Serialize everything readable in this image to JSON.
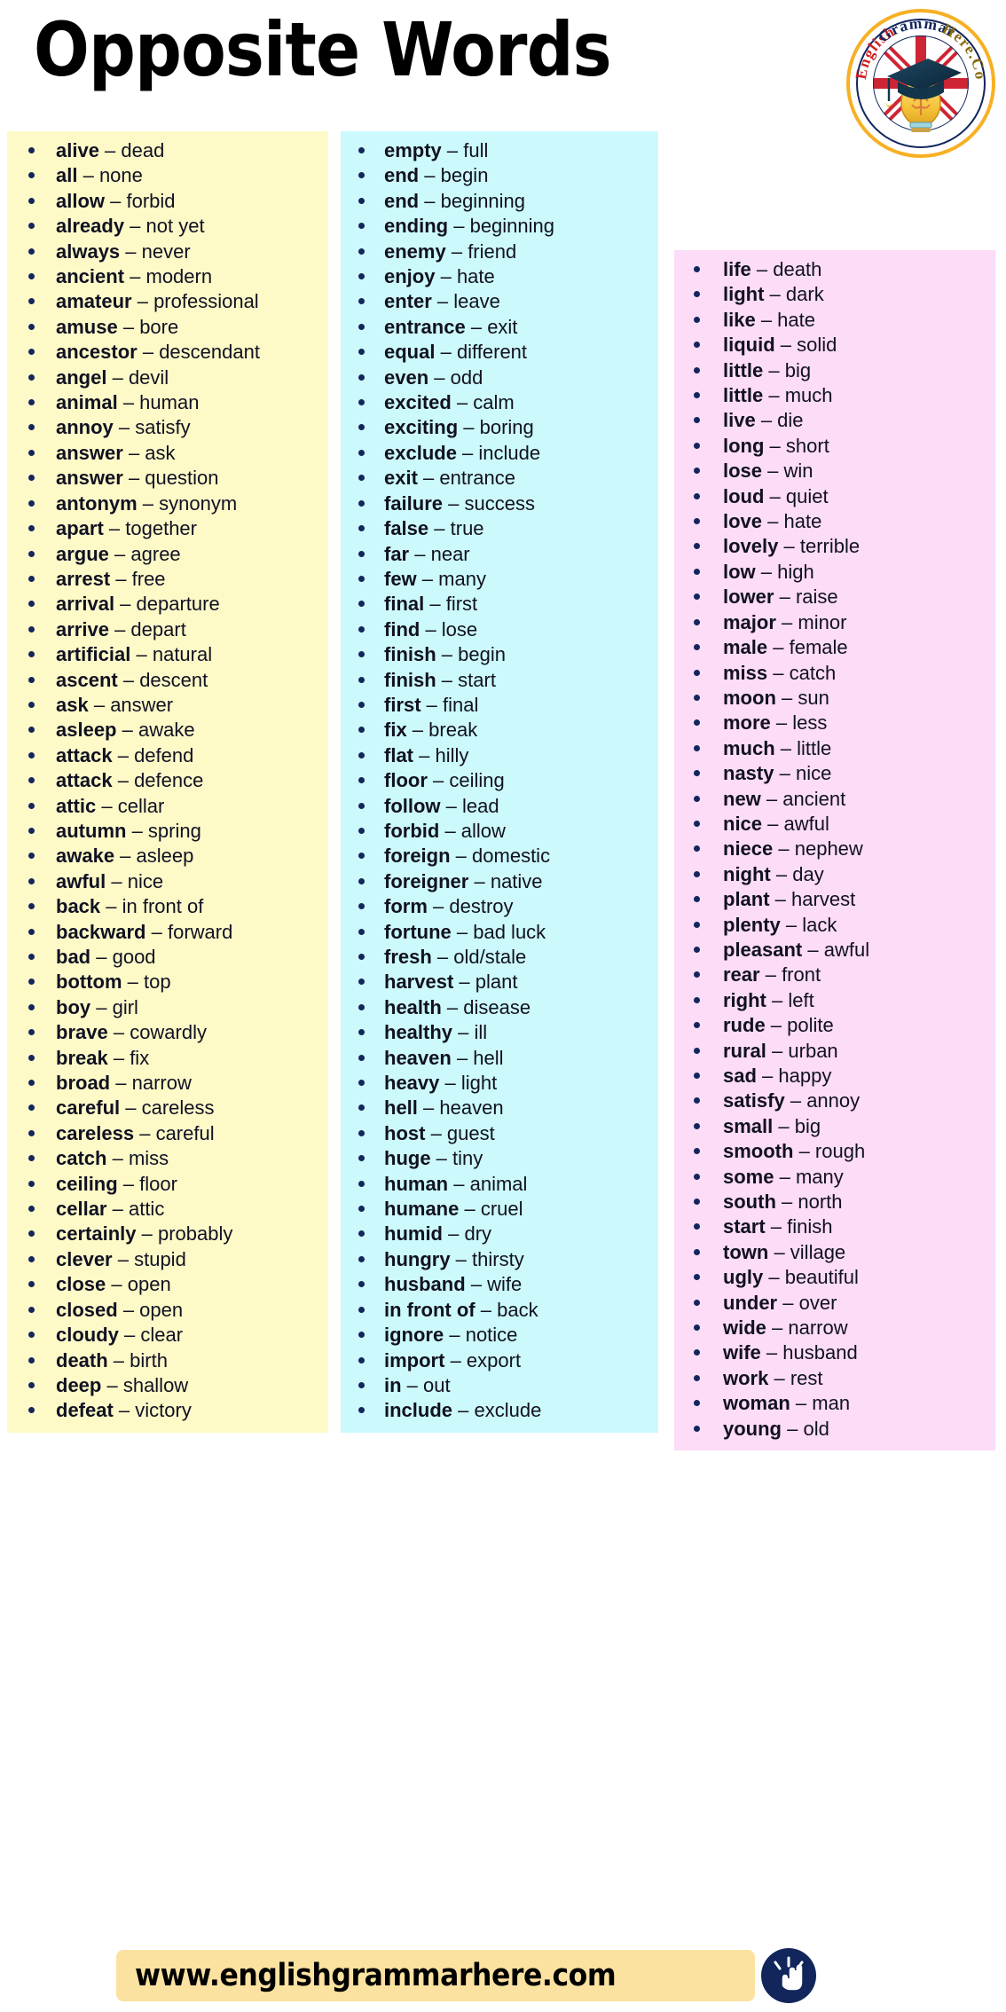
{
  "header": {
    "title": "Opposite Words",
    "logo": {
      "text": "English Grammar Here.Com",
      "alt_name": "english-grammar-here-logo",
      "ring_color": "#f7b024",
      "text_color_left": "#d42020",
      "text_color_mid": "#12265c",
      "text_color_right": "#8a6a10"
    }
  },
  "colors": {
    "column1_bg": "#fdfac8",
    "column2_bg": "#ccf9fb",
    "column3_bg": "#fcdcf6",
    "bullet": "#12265c",
    "text": "#111122",
    "footer_pill": "#fbe2a0",
    "footer_icon": "#12265c"
  },
  "columns": [
    {
      "name": "column-1",
      "bg": "#fdfac8",
      "pairs": [
        {
          "word": "alive",
          "opposite": "dead"
        },
        {
          "word": "all",
          "opposite": "none"
        },
        {
          "word": "allow",
          "opposite": "forbid"
        },
        {
          "word": "already",
          "opposite": "not yet"
        },
        {
          "word": "always",
          "opposite": "never"
        },
        {
          "word": "ancient",
          "opposite": "modern"
        },
        {
          "word": "amateur",
          "opposite": "professional"
        },
        {
          "word": "amuse",
          "opposite": "bore"
        },
        {
          "word": "ancestor",
          "opposite": "descendant"
        },
        {
          "word": "angel",
          "opposite": "devil"
        },
        {
          "word": "animal",
          "opposite": "human"
        },
        {
          "word": "annoy",
          "opposite": "satisfy"
        },
        {
          "word": "answer",
          "opposite": "ask"
        },
        {
          "word": "answer",
          "opposite": "question"
        },
        {
          "word": "antonym",
          "opposite": "synonym"
        },
        {
          "word": "apart",
          "opposite": "together"
        },
        {
          "word": "argue",
          "opposite": "agree"
        },
        {
          "word": "arrest",
          "opposite": "free"
        },
        {
          "word": "arrival",
          "opposite": "departure"
        },
        {
          "word": "arrive",
          "opposite": "depart"
        },
        {
          "word": "artificial",
          "opposite": "natural"
        },
        {
          "word": "ascent",
          "opposite": "descent"
        },
        {
          "word": "ask",
          "opposite": "answer"
        },
        {
          "word": "asleep",
          "opposite": "awake"
        },
        {
          "word": "attack",
          "opposite": "defend"
        },
        {
          "word": "attack",
          "opposite": "defence"
        },
        {
          "word": "attic",
          "opposite": "cellar"
        },
        {
          "word": "autumn",
          "opposite": "spring"
        },
        {
          "word": "awake",
          "opposite": "asleep"
        },
        {
          "word": "awful",
          "opposite": "nice"
        },
        {
          "word": "back",
          "opposite": "in front of"
        },
        {
          "word": "backward",
          "opposite": "forward"
        },
        {
          "word": "bad",
          "opposite": "good"
        },
        {
          "word": "bottom",
          "opposite": "top"
        },
        {
          "word": "boy",
          "opposite": "girl"
        },
        {
          "word": "brave",
          "opposite": "cowardly"
        },
        {
          "word": "break",
          "opposite": "fix"
        },
        {
          "word": "broad",
          "opposite": "narrow"
        },
        {
          "word": "careful",
          "opposite": "careless"
        },
        {
          "word": "careless",
          "opposite": "careful"
        },
        {
          "word": "catch",
          "opposite": "miss"
        },
        {
          "word": "ceiling",
          "opposite": "floor"
        },
        {
          "word": "cellar",
          "opposite": "attic"
        },
        {
          "word": "certainly",
          "opposite": "probably"
        },
        {
          "word": "clever",
          "opposite": "stupid"
        },
        {
          "word": "close",
          "opposite": "open"
        },
        {
          "word": "closed",
          "opposite": "open"
        },
        {
          "word": "cloudy",
          "opposite": "clear"
        },
        {
          "word": "death",
          "opposite": "birth"
        },
        {
          "word": "deep",
          "opposite": "shallow"
        },
        {
          "word": "defeat",
          "opposite": "victory"
        }
      ]
    },
    {
      "name": "column-2",
      "bg": "#ccf9fb",
      "pairs": [
        {
          "word": "empty",
          "opposite": "full"
        },
        {
          "word": "end",
          "opposite": "begin"
        },
        {
          "word": "end",
          "opposite": "beginning"
        },
        {
          "word": "ending",
          "opposite": "beginning"
        },
        {
          "word": "enemy",
          "opposite": "friend"
        },
        {
          "word": "enjoy",
          "opposite": "hate"
        },
        {
          "word": "enter",
          "opposite": "leave"
        },
        {
          "word": "entrance",
          "opposite": "exit"
        },
        {
          "word": "equal",
          "opposite": "different"
        },
        {
          "word": "even",
          "opposite": "odd"
        },
        {
          "word": "excited",
          "opposite": "calm"
        },
        {
          "word": "exciting",
          "opposite": "boring"
        },
        {
          "word": "exclude",
          "opposite": "include"
        },
        {
          "word": "exit",
          "opposite": "entrance"
        },
        {
          "word": "failure",
          "opposite": "success"
        },
        {
          "word": "false",
          "opposite": "true"
        },
        {
          "word": "far",
          "opposite": "near"
        },
        {
          "word": "few",
          "opposite": "many"
        },
        {
          "word": "final",
          "opposite": "first"
        },
        {
          "word": "find",
          "opposite": "lose"
        },
        {
          "word": "finish",
          "opposite": "begin"
        },
        {
          "word": "finish",
          "opposite": "start"
        },
        {
          "word": "first",
          "opposite": "final"
        },
        {
          "word": "fix",
          "opposite": "break"
        },
        {
          "word": "flat",
          "opposite": "hilly"
        },
        {
          "word": "floor",
          "opposite": "ceiling"
        },
        {
          "word": "follow",
          "opposite": "lead"
        },
        {
          "word": "forbid",
          "opposite": "allow"
        },
        {
          "word": "foreign",
          "opposite": "domestic"
        },
        {
          "word": "foreigner",
          "opposite": "native"
        },
        {
          "word": "form",
          "opposite": "destroy"
        },
        {
          "word": "fortune",
          "opposite": "bad luck"
        },
        {
          "word": "fresh",
          "opposite": "old/stale"
        },
        {
          "word": "harvest",
          "opposite": "plant"
        },
        {
          "word": "health",
          "opposite": "disease"
        },
        {
          "word": "healthy",
          "opposite": "ill"
        },
        {
          "word": "heaven",
          "opposite": "hell"
        },
        {
          "word": "heavy",
          "opposite": "light"
        },
        {
          "word": "hell",
          "opposite": "heaven"
        },
        {
          "word": "host",
          "opposite": "guest"
        },
        {
          "word": "huge",
          "opposite": "tiny"
        },
        {
          "word": "human",
          "opposite": "animal"
        },
        {
          "word": "humane",
          "opposite": "cruel"
        },
        {
          "word": "humid",
          "opposite": "dry"
        },
        {
          "word": "hungry",
          "opposite": "thirsty"
        },
        {
          "word": "husband",
          "opposite": "wife"
        },
        {
          "word": "in front of",
          "opposite": "back"
        },
        {
          "word": "ignore",
          "opposite": "notice"
        },
        {
          "word": "import",
          "opposite": "export"
        },
        {
          "word": "in",
          "opposite": "out"
        },
        {
          "word": "include",
          "opposite": "exclude"
        }
      ]
    },
    {
      "name": "column-3",
      "bg": "#fcdcf6",
      "pairs": [
        {
          "word": "life",
          "opposite": "death"
        },
        {
          "word": "light",
          "opposite": "dark"
        },
        {
          "word": "like",
          "opposite": "hate"
        },
        {
          "word": "liquid",
          "opposite": "solid"
        },
        {
          "word": "little",
          "opposite": "big"
        },
        {
          "word": "little",
          "opposite": "much"
        },
        {
          "word": "live",
          "opposite": "die"
        },
        {
          "word": "long",
          "opposite": "short"
        },
        {
          "word": "lose",
          "opposite": "win"
        },
        {
          "word": "loud",
          "opposite": "quiet"
        },
        {
          "word": "love",
          "opposite": "hate"
        },
        {
          "word": "lovely",
          "opposite": "terrible"
        },
        {
          "word": "low",
          "opposite": "high"
        },
        {
          "word": "lower",
          "opposite": "raise"
        },
        {
          "word": "major",
          "opposite": "minor"
        },
        {
          "word": "male",
          "opposite": "female"
        },
        {
          "word": "miss",
          "opposite": "catch"
        },
        {
          "word": "moon",
          "opposite": "sun"
        },
        {
          "word": "more",
          "opposite": "less"
        },
        {
          "word": "much",
          "opposite": "little"
        },
        {
          "word": "nasty",
          "opposite": "nice"
        },
        {
          "word": "new",
          "opposite": "ancient"
        },
        {
          "word": "nice",
          "opposite": "awful"
        },
        {
          "word": "niece",
          "opposite": "nephew"
        },
        {
          "word": "night",
          "opposite": "day"
        },
        {
          "word": "plant",
          "opposite": "harvest"
        },
        {
          "word": "plenty",
          "opposite": "lack"
        },
        {
          "word": "pleasant",
          "opposite": "awful"
        },
        {
          "word": "rear",
          "opposite": "front"
        },
        {
          "word": "right",
          "opposite": "left"
        },
        {
          "word": "rude",
          "opposite": "polite"
        },
        {
          "word": "rural",
          "opposite": "urban"
        },
        {
          "word": "sad",
          "opposite": "happy"
        },
        {
          "word": "satisfy",
          "opposite": "annoy"
        },
        {
          "word": "small",
          "opposite": "big"
        },
        {
          "word": "smooth",
          "opposite": "rough"
        },
        {
          "word": "some",
          "opposite": "many"
        },
        {
          "word": "south",
          "opposite": "north"
        },
        {
          "word": "start",
          "opposite": "finish"
        },
        {
          "word": "town",
          "opposite": "village"
        },
        {
          "word": "ugly",
          "opposite": "beautiful"
        },
        {
          "word": "under",
          "opposite": "over"
        },
        {
          "word": "wide",
          "opposite": "narrow"
        },
        {
          "word": "wife",
          "opposite": "husband"
        },
        {
          "word": "work",
          "opposite": "rest"
        },
        {
          "word": "woman",
          "opposite": "man"
        },
        {
          "word": "young",
          "opposite": "old"
        }
      ]
    }
  ],
  "separator": "–",
  "footer": {
    "url": "www.englishgrammarhere.com",
    "click_icon": "pointing-hand-click-icon"
  }
}
